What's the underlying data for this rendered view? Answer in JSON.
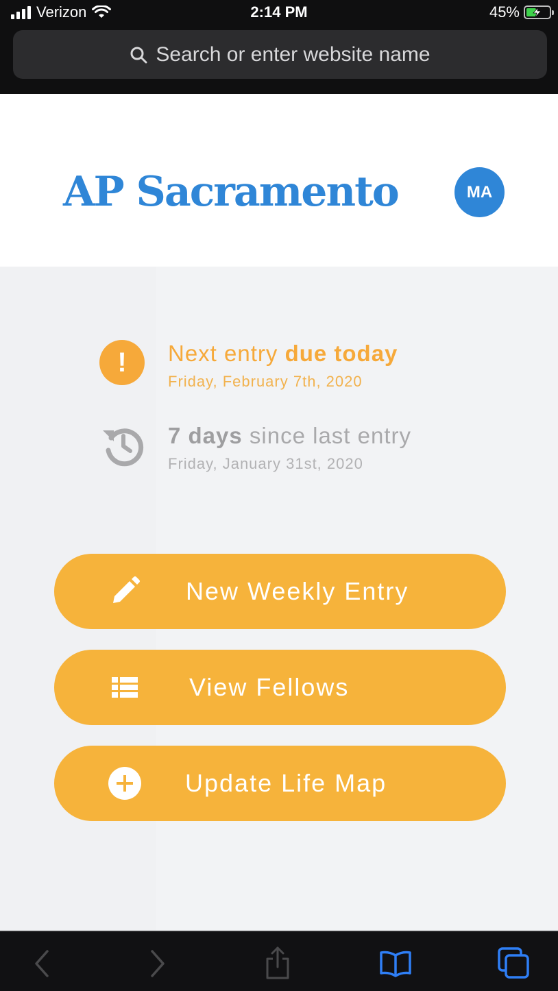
{
  "status_bar": {
    "carrier": "Verizon",
    "time": "2:14 PM",
    "battery_percent": "45%",
    "battery_level": 0.45,
    "icons": [
      "signal-icon",
      "wifi-icon",
      "battery-charging-icon"
    ]
  },
  "browser": {
    "search_placeholder": "Search or enter website name"
  },
  "header": {
    "title": "AP Sacramento",
    "avatar_initials": "MA"
  },
  "status": {
    "due": {
      "prefix": "Next entry ",
      "emphasis": "due today",
      "date": "Friday, February 7th, 2020",
      "icon": "exclamation-icon"
    },
    "since": {
      "emphasis": "7 days",
      "suffix": " since last entry",
      "date": "Friday, January 31st, 2020",
      "icon": "history-icon"
    }
  },
  "actions": [
    {
      "label": "New Weekly Entry",
      "icon": "pencil-icon"
    },
    {
      "label": "View Fellows",
      "icon": "list-icon"
    },
    {
      "label": "Update Life Map",
      "icon": "plus-circle-icon"
    }
  ],
  "toolbar": {
    "items": [
      "back-icon",
      "forward-icon",
      "share-icon",
      "bookmarks-icon",
      "tabs-icon"
    ]
  },
  "colors": {
    "brand_blue": "#2f86d7",
    "accent_orange": "#f6b33b",
    "warning_orange": "#f6a93a",
    "muted_gray": "#a9a9ab",
    "safari_blue": "#2f7ff6"
  }
}
